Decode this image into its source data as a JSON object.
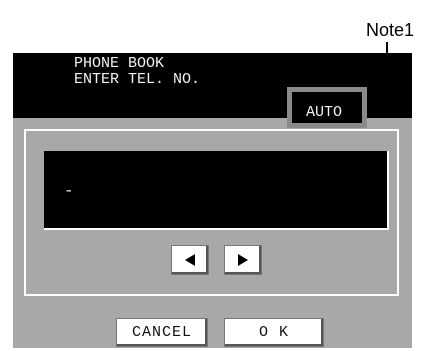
{
  "note": {
    "label": "Note1"
  },
  "header": {
    "line1": "PHONE BOOK",
    "line2": "ENTER TEL. NO.",
    "mode_badge": "AUTO"
  },
  "display": {
    "value": "-"
  },
  "nav": {
    "left_icon": "left-triangle-icon",
    "right_icon": "right-triangle-icon"
  },
  "buttons": {
    "cancel": "CANCEL",
    "ok": "O K"
  }
}
